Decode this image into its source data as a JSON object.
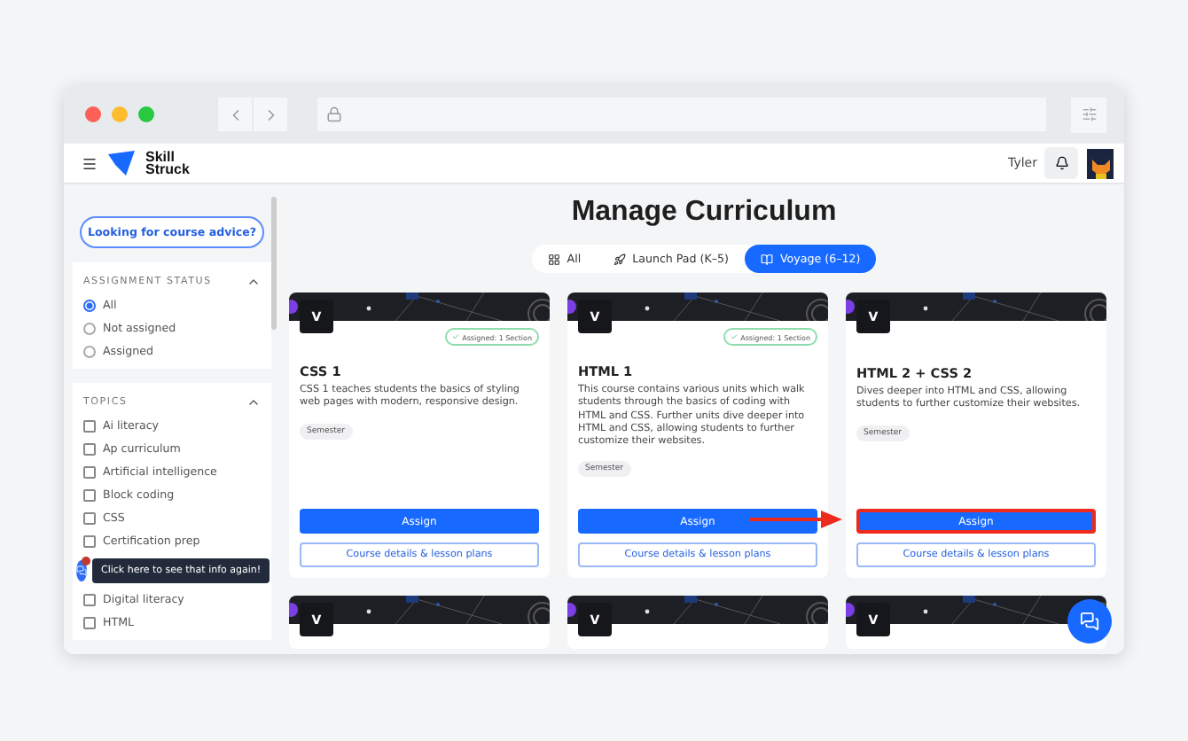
{
  "header": {
    "brand": [
      "Skill",
      "Struck"
    ],
    "user": "Tyler"
  },
  "sidebar": {
    "advice_button": "Looking for course advice?",
    "status": {
      "title": "ASSIGNMENT STATUS",
      "expanded": true,
      "options": [
        {
          "label": "All",
          "selected": true
        },
        {
          "label": "Not assigned",
          "selected": false
        },
        {
          "label": "Assigned",
          "selected": false
        }
      ]
    },
    "topics": {
      "title": "TOPICS",
      "expanded": true,
      "items": [
        {
          "kind": "checkbox",
          "label": "Ai literacy",
          "checked": false
        },
        {
          "kind": "checkbox",
          "label": "Ap curriculum",
          "checked": false
        },
        {
          "kind": "checkbox",
          "label": "Artificial intelligence",
          "checked": false
        },
        {
          "kind": "checkbox",
          "label": "Block coding",
          "checked": false
        },
        {
          "kind": "checkbox",
          "label": "CSS",
          "checked": false
        },
        {
          "kind": "checkbox",
          "label": "Certification prep",
          "checked": false
        },
        {
          "kind": "help",
          "label": "Click here to see that info again!"
        },
        {
          "kind": "checkbox",
          "label": "Digital literacy",
          "checked": false
        },
        {
          "kind": "checkbox",
          "label": "HTML",
          "checked": false
        }
      ]
    }
  },
  "main": {
    "title": "Manage Curriculum",
    "tabs": [
      {
        "label": "All",
        "selected": false
      },
      {
        "label": "Launch Pad (K–5)",
        "selected": false
      },
      {
        "label": "Voyage (6–12)",
        "selected": true
      }
    ],
    "cards": [
      {
        "badge": "V",
        "assigned": "Assigned: 1 Section",
        "title": "CSS 1",
        "description": "CSS 1 teaches students the basics of styling web pages with modern, responsive design.",
        "tag": "Semester",
        "assign": "Assign",
        "details": "Course details & lesson plans",
        "highlighted": false
      },
      {
        "badge": "V",
        "assigned": "Assigned: 1 Section",
        "title": "HTML 1",
        "description": "This course contains various units which walk students through the basics of coding with HTML and CSS. Further units dive deeper into HTML and CSS, allowing students to further customize their websites.",
        "tag": "Semester",
        "assign": "Assign",
        "details": "Course details & lesson plans",
        "highlighted": false
      },
      {
        "badge": "V",
        "title": "HTML 2 + CSS 2",
        "description": "Dives deeper into HTML and CSS, allowing students to further customize their websites.",
        "tag": "Semester",
        "assign": "Assign",
        "details": "Course details & lesson plans",
        "highlighted": true
      },
      {
        "badge": "V"
      },
      {
        "badge": "V"
      },
      {
        "badge": "V"
      }
    ]
  }
}
